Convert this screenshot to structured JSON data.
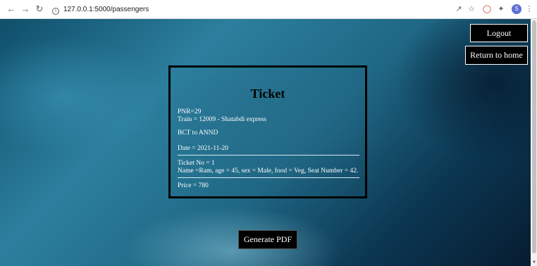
{
  "browser": {
    "url": "127.0.0.1:5000/passengers",
    "profile_initial": "S",
    "colors": {
      "profile": "#5b6fd6"
    }
  },
  "header": {
    "logout_label": "Logout",
    "home_label": "Return to home"
  },
  "ticket": {
    "title": "Ticket",
    "pnr": "PNR=29",
    "train": "Train = 12009 - Shatabdi express",
    "route": "BCT to ANND",
    "date": "Date = 2021-11-20",
    "ticket_no": "Ticket No = 1",
    "passenger": "Name =Ram, age = 45, sex = Male, food = Veg, Seat Number = 42.",
    "price": "Price = 780"
  },
  "actions": {
    "generate_pdf_label": "Generate PDF"
  }
}
